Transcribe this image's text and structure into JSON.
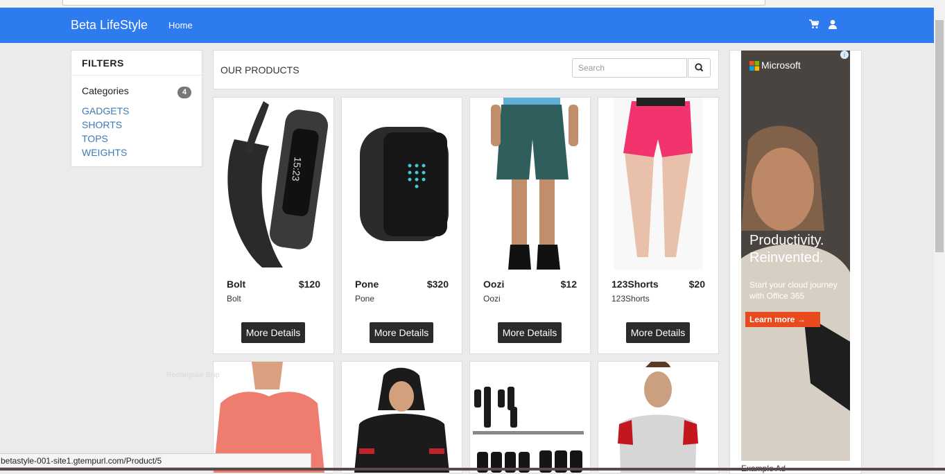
{
  "navbar": {
    "brand": "Beta LifeStyle",
    "home": "Home",
    "cart_icon": "cart-icon",
    "user_icon": "user-icon",
    "color": "#2e7bf0"
  },
  "filters": {
    "title": "FILTERS",
    "categories_label": "Categories",
    "count": "4",
    "items": [
      "GADGETS",
      "SHORTS",
      "TOPS",
      "WEIGHTS"
    ]
  },
  "products_header": {
    "title": "OUR PRODUCTS",
    "search_placeholder": "Search",
    "search_icon": "search-icon"
  },
  "products": [
    {
      "name": "Bolt",
      "price": "$120",
      "sub": "Bolt",
      "button": "More Details"
    },
    {
      "name": "Pone",
      "price": "$320",
      "sub": "Pone",
      "button": "More Details"
    },
    {
      "name": "Oozi",
      "price": "$12",
      "sub": "Oozi",
      "button": "More Details"
    },
    {
      "name": "123Shorts",
      "price": "$20",
      "sub": "123Shorts",
      "button": "More Details"
    }
  ],
  "ad": {
    "brand": "Microsoft",
    "headline1": "Productivity.",
    "headline2": "Reinvented.",
    "body": "Start your cloud journey with Office 365",
    "cta": "Learn more →",
    "footer": "Example Ad",
    "info": "i"
  },
  "ghost_text": "Rectangular Snip",
  "status_url": "betastyle-001-site1.gtempurl.com/Product/5"
}
